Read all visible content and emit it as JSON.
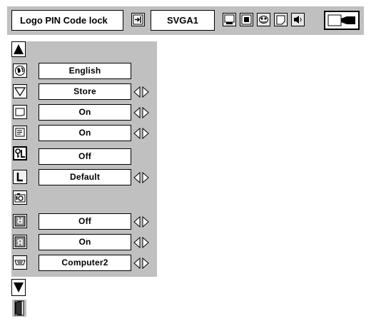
{
  "topbar": {
    "title": "Logo PIN Code lock",
    "mode": "SVGA1",
    "icons": [
      "input-icon",
      "pc-adjust-icon",
      "image-select-icon",
      "image-adjust-icon",
      "screen-icon",
      "sound-icon",
      "setting-icon"
    ]
  },
  "menu": {
    "scroll_up_icon": "triangle-up-icon",
    "scroll_down_icon": "triangle-down-icon",
    "exit_icon": "exit-door-icon",
    "rows": [
      {
        "icon": "language-globe-icon",
        "value": "English",
        "arrows": false
      },
      {
        "icon": "keystone-icon",
        "value": "Store",
        "arrows": true
      },
      {
        "icon": "blue-back-icon",
        "value": "On",
        "arrows": true
      },
      {
        "icon": "display-icon",
        "value": "On",
        "arrows": true
      },
      {
        "icon": "logo-pin-lock-icon",
        "value": "Off",
        "arrows": false,
        "selected": true
      },
      {
        "icon": "logo-icon",
        "value": "Default",
        "arrows": true
      },
      {
        "icon": "capture-camera-icon",
        "value": "",
        "arrows": false
      },
      {
        "icon": "ceiling-icon",
        "value": "Off",
        "arrows": true
      },
      {
        "icon": "rear-icon",
        "value": "On",
        "arrows": true
      },
      {
        "icon": "terminal-icon",
        "value": "Computer2",
        "arrows": true
      }
    ]
  }
}
